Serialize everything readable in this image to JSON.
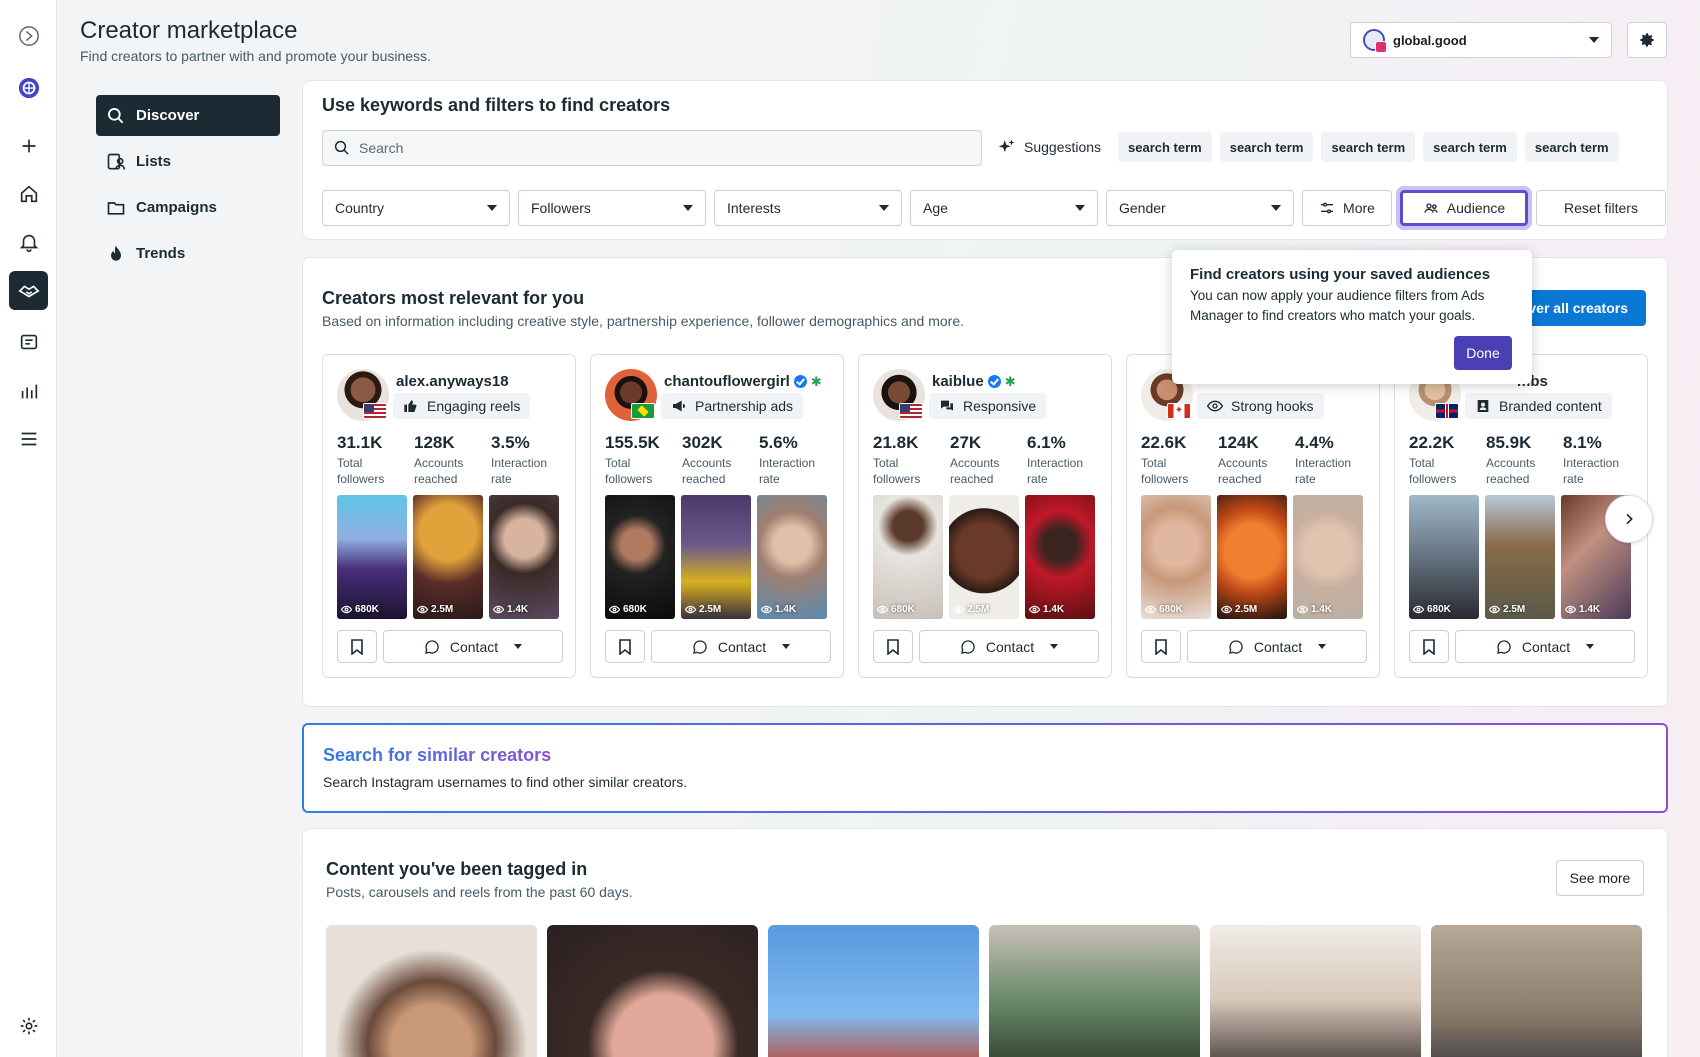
{
  "header": {
    "title": "Creator marketplace",
    "subtitle": "Find creators to partner with and promote your business.",
    "account": "global.good"
  },
  "sidebar": {
    "items": [
      {
        "label": "Discover",
        "icon": "search-icon",
        "active": true
      },
      {
        "label": "Lists",
        "icon": "list-person-icon"
      },
      {
        "label": "Campaigns",
        "icon": "folder-icon"
      },
      {
        "label": "Trends",
        "icon": "flame-icon"
      }
    ]
  },
  "search": {
    "title": "Use keywords and filters to find creators",
    "placeholder": "Search",
    "suggestions_label": "Suggestions",
    "chips": [
      "search term",
      "search term",
      "search term",
      "search term",
      "search term"
    ],
    "filters": [
      "Country",
      "Followers",
      "Interests",
      "Age",
      "Gender"
    ],
    "more_label": "More",
    "audience_label": "Audience",
    "reset_label": "Reset filters"
  },
  "relevant": {
    "title": "Creators most relevant for you",
    "subtitle": "Based on information including creative style, partnership experience, follower demographics and more.",
    "discover_label": "over all creators",
    "contact_label": "Contact",
    "creators": [
      {
        "name": "alex.anyways18",
        "verified": false,
        "tag": "Engaging reels",
        "tag_icon": "thumbs-up-icon",
        "stats": [
          {
            "value": "31.1K",
            "l1": "Total",
            "l2": "followers"
          },
          {
            "value": "128K",
            "l1": "Accounts",
            "l2": "reached"
          },
          {
            "value": "3.5%",
            "l1": "Interaction",
            "l2": "rate"
          }
        ],
        "views": [
          "680K",
          "2.5M",
          "1.4K"
        ]
      },
      {
        "name": "chantouflowergirl",
        "verified": true,
        "tag": "Partnership ads",
        "tag_icon": "megaphone-icon",
        "stats": [
          {
            "value": "155.5K",
            "l1": "Total",
            "l2": "followers"
          },
          {
            "value": "302K",
            "l1": "Accounts",
            "l2": "reached"
          },
          {
            "value": "5.6%",
            "l1": "Interaction",
            "l2": "rate"
          }
        ],
        "views": [
          "680K",
          "2.5M",
          "1.4K"
        ]
      },
      {
        "name": "kaiblue",
        "verified": true,
        "tag": "Responsive",
        "tag_icon": "chat-bubbles-icon",
        "stats": [
          {
            "value": "21.8K",
            "l1": "Total",
            "l2": "followers"
          },
          {
            "value": "27K",
            "l1": "Accounts",
            "l2": "reached"
          },
          {
            "value": "6.1%",
            "l1": "Interaction",
            "l2": "rate"
          }
        ],
        "views": [
          "680K",
          "2.5M",
          "1.4K"
        ]
      },
      {
        "name": "",
        "verified": false,
        "tag": "Strong hooks",
        "tag_icon": "eye-icon",
        "stats": [
          {
            "value": "22.6K",
            "l1": "Total",
            "l2": "followers"
          },
          {
            "value": "124K",
            "l1": "Accounts",
            "l2": "reached"
          },
          {
            "value": "4.4%",
            "l1": "Interaction",
            "l2": "rate"
          }
        ],
        "views": [
          "680K",
          "2.5M",
          "1.4K"
        ]
      },
      {
        "name": "mbs",
        "verified": false,
        "tag": "Branded content",
        "tag_icon": "badge-icon",
        "stats": [
          {
            "value": "22.2K",
            "l1": "Total",
            "l2": "followers"
          },
          {
            "value": "85.9K",
            "l1": "Accounts",
            "l2": "reached"
          },
          {
            "value": "8.1%",
            "l1": "Interaction",
            "l2": "rate"
          }
        ],
        "views": [
          "680K",
          "2.5M",
          "1.4K"
        ]
      }
    ]
  },
  "popover": {
    "title": "Find creators using your saved audiences",
    "text": "You can now apply your audience filters from Ads Manager to find creators who match your goals.",
    "done_label": "Done"
  },
  "similar": {
    "title": "Search for similar creators",
    "subtitle": "Search Instagram usernames to find other similar creators."
  },
  "tagged": {
    "title": "Content you've been tagged in",
    "subtitle": "Posts, carousels and reels from the past 60 days.",
    "see_more_label": "See more"
  },
  "colors": {
    "dark_nav": "#1c2b33",
    "primary_blue": "#0a78d4",
    "audience_highlight": "#5b4ccb",
    "done_button": "#4b3fb5"
  }
}
